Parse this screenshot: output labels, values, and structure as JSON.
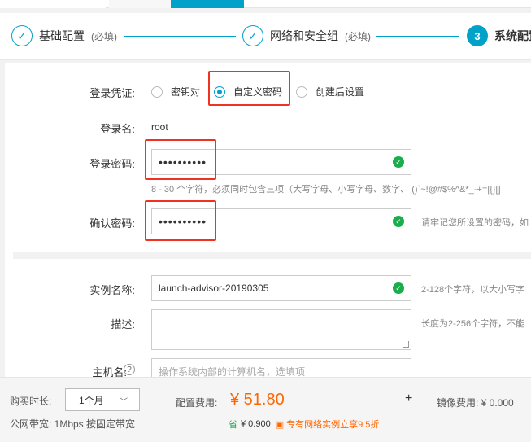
{
  "steps": [
    {
      "title": "基础配置",
      "req": "(必填)",
      "icon": "check"
    },
    {
      "title": "网络和安全组",
      "req": "(必填)",
      "icon": "check"
    },
    {
      "number": "3",
      "title": "系统配置"
    }
  ],
  "form": {
    "credential": {
      "label": "登录凭证:",
      "options": [
        "密钥对",
        "自定义密码",
        "创建后设置"
      ],
      "selected": "自定义密码"
    },
    "login_name": {
      "label": "登录名:",
      "value": "root"
    },
    "password": {
      "label": "登录密码:",
      "value": "••••••••••",
      "hint": "8 - 30 个字符，必须同时包含三项（大写字母、小写字母、数字、 ()`~!@#$%^&*_-+=|{}[]"
    },
    "confirm": {
      "label": "确认密码:",
      "value": "••••••••••",
      "hint": "请牢记您所设置的密码，如"
    },
    "instance_name": {
      "label": "实例名称:",
      "value": "launch-advisor-20190305",
      "hint": "2-128个字符，以大小写字"
    },
    "description": {
      "label": "描述:",
      "hint": "长度为2-256个字符，不能"
    },
    "hostname": {
      "label": "主机名:",
      "help": "?",
      "placeholder": "操作系统内部的计算机名，选填项"
    }
  },
  "bottom": {
    "duration_label": "购买时长:",
    "duration_value": "1个月",
    "bandwidth": "公网带宽: 1Mbps 按固定带宽",
    "config_fee_label": "配置费用:",
    "config_fee": "¥ 51.80",
    "plus": "+",
    "image_fee": "镜像费用: ¥ 0.000",
    "saving_icon": "省",
    "saving": "¥ 0.900",
    "promo": "专有网络实例立享9.5折"
  },
  "colors": {
    "accent": "#00a2ca",
    "price": "#ff6600",
    "ok": "#1aad4b",
    "highlight": "#ee3322"
  }
}
